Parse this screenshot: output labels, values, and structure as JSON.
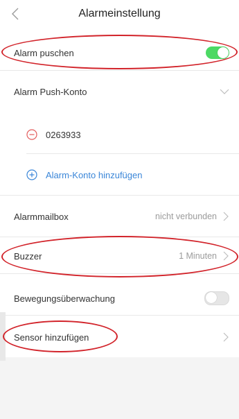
{
  "header": {
    "title": "Alarmeinstellung",
    "back_icon": "chevron-left-icon"
  },
  "settings": {
    "push_alarm": {
      "label": "Alarm puschen",
      "enabled": true
    },
    "push_account": {
      "label": "Alarm Push-Konto"
    },
    "account_entry": {
      "value": "0263933"
    },
    "add_account": {
      "label": "Alarm-Konto hinzufügen"
    },
    "mailbox": {
      "label": "Alarmmailbox",
      "value": "nicht verbunden"
    },
    "buzzer": {
      "label": "Buzzer",
      "value": "1 Minuten"
    },
    "motion": {
      "label": "Bewegungsüberwachung",
      "enabled": false
    },
    "sensor": {
      "label": "Sensor hinzufügen"
    }
  },
  "colors": {
    "toggle_on": "#4cd964",
    "link_blue": "#3a86d8",
    "remove_red": "#e35d5d",
    "annotation_red": "#d2232a"
  }
}
